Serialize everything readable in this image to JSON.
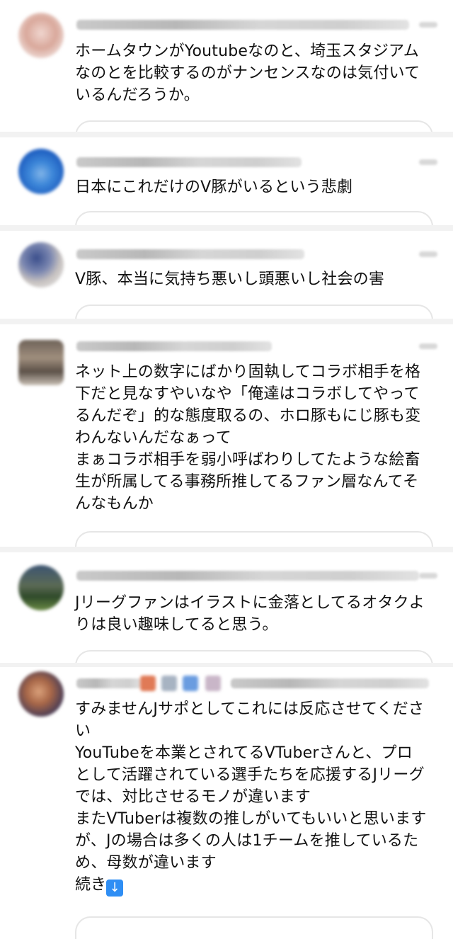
{
  "posts": [
    {
      "text": "ホームタウンがYoutubeなのと、埼玉スタジアム\nなのとを比較するのがナンセンスなのは気付いて\nいるんだろうか。"
    },
    {
      "text": "日本にこれだけのV豚がいるという悲劇"
    },
    {
      "text": "V豚、本当に気持ち悪いし頭悪いし社会の害"
    },
    {
      "text": "ネット上の数字にばかり固執してコラボ相手を格\n下だと見なすやいなや「俺達はコラボしてやって\nるんだぞ」的な態度取るの、ホロ豚もにじ豚も変\nわんないんだなぁって\nまぁコラボ相手を弱小呼ばわりしてたような絵畜\n生が所属してる事務所推してるファン層なんてそ\nんなもんか"
    },
    {
      "text": "Jリーグファンはイラストに金落としてるオタクよ\nりは良い趣味してると思う。"
    },
    {
      "text": "すみませんJサポとしてこれには反応させてくださ\nい\nYouTubeを本業とされてるVTuberさんと、プロ\nとして活躍されている選手たちを応援するJリーグ\nでは、対比させるモノが違います\nまたVTuberは複数の推しがいてもいいと思います\nが、Jの場合は多くの人は1チームを推しているた\nめ、母数が違います",
      "continue_label": "続き",
      "continue_icon": "down-arrow-icon"
    }
  ]
}
